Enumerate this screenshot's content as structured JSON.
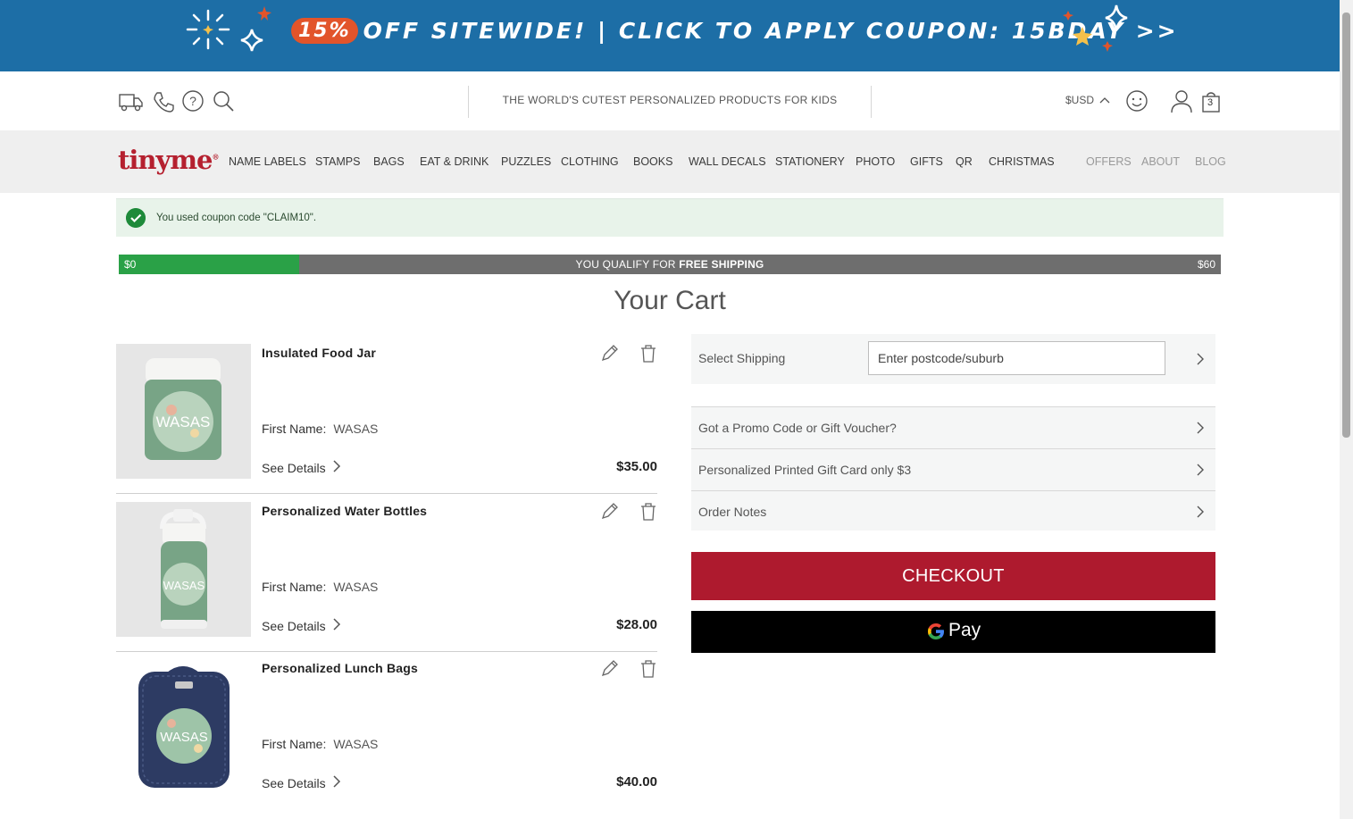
{
  "promo": {
    "percent": "15%",
    "text": "OFF SITEWIDE! | CLICK TO APPLY COUPON: 15BDAY >>",
    "bg_color": "#1d6ea6",
    "pill_color": "#e2542a"
  },
  "utility": {
    "icons": [
      "truck-icon",
      "phone-icon",
      "help-icon",
      "search-icon"
    ],
    "tagline": "THE WORLD'S CUTEST PERSONALIZED PRODUCTS FOR KIDS",
    "currency": "$USD",
    "cart_count": "3"
  },
  "nav": {
    "logo": "tinyme",
    "items": [
      "NAME LABELS",
      "STAMPS",
      "BAGS",
      "EAT & DRINK",
      "PUZZLES",
      "CLOTHING",
      "BOOKS",
      "WALL DECALS",
      "STATIONERY",
      "PHOTO",
      "GIFTS",
      "QR",
      "CHRISTMAS"
    ],
    "secondary": [
      "OFFERS",
      "ABOUT",
      "BLOG"
    ]
  },
  "notice": {
    "text": "You used coupon code \"CLAIM10\"."
  },
  "shipping_progress": {
    "min": "$0",
    "max": "$60",
    "label_prefix": "YOU QUALIFY FOR ",
    "label_bold": "FREE SHIPPING",
    "fill_fraction": 0.164,
    "fill_color": "#2aa147"
  },
  "cart": {
    "title": "Your Cart",
    "items": [
      {
        "name": "Insulated Food Jar",
        "option_label": "First Name:",
        "option_value": "WASAS",
        "details_label": "See Details",
        "price": "$35.00",
        "image_text": "WASAS"
      },
      {
        "name": "Personalized Water Bottles",
        "option_label": "First Name:",
        "option_value": "WASAS",
        "details_label": "See Details",
        "price": "$28.00",
        "image_text": "WASAS"
      },
      {
        "name": "Personalized Lunch Bags",
        "option_label": "First Name:",
        "option_value": "WASAS",
        "details_label": "See Details",
        "price": "$40.00",
        "image_text": "WASAS"
      }
    ]
  },
  "panel": {
    "shipping_label": "Select Shipping",
    "shipping_placeholder": "Enter postcode/suburb",
    "promo_label": "Got a Promo Code or Gift Voucher?",
    "giftcard_label": "Personalized Printed Gift Card only $3",
    "notes_label": "Order Notes",
    "checkout_label": "CHECKOUT",
    "checkout_color": "#ae1a2e",
    "gpay_label": "Pay"
  }
}
